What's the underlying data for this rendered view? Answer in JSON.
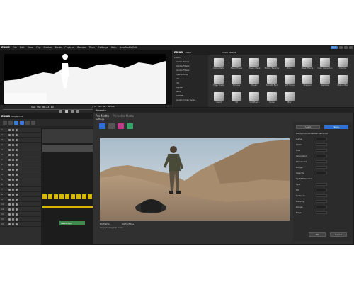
{
  "menubar": {
    "brand": "EDIUS",
    "items": [
      "File",
      "Edit",
      "View",
      "Clip",
      "Marker",
      "Mode",
      "Capture",
      "Render",
      "Tools",
      "Settings",
      "Help",
      "NewProfileEdit"
    ],
    "project_badge": "PLR"
  },
  "player": {
    "timecode": "Sup 00:00:23;10",
    "out_timecode": "TTL 00:00:10;08"
  },
  "bin": {
    "brand": "EDIUS",
    "header": "Folder",
    "tab_label": "Effect Palette",
    "tree": [
      "Effect",
      "Video Filters",
      "Alpha Filters",
      "Audio Filters",
      "Transitions",
      "2D",
      "3D",
      "Alpha",
      "GPU",
      "SMPTE",
      "Audio Cross Fades"
    ],
    "tiles": [
      {
        "label": "Alpha Matte"
      },
      {
        "label": "Blend Filters"
      },
      {
        "label": "Mosaic Mask"
      },
      {
        "label": "Motion Tracking"
      },
      {
        "label": "Proc..."
      },
      {
        "label": "Mask Effects"
      },
      {
        "label": "Color Correction"
      },
      {
        "label": "Chroma"
      },
      {
        "label": "Edge Shade"
      },
      {
        "label": "Emboss"
      },
      {
        "label": "Mosaic"
      },
      {
        "label": "Smooth Blur"
      },
      {
        "label": "Soft Focus"
      },
      {
        "label": "Sharpen"
      },
      {
        "label": "Stabilizer"
      },
      {
        "label": "Motion Blur"
      },
      {
        "label": "Invert"
      },
      {
        "label": "3D"
      },
      {
        "label": "Old Movie"
      },
      {
        "label": "Noise"
      },
      {
        "label": "Blur"
      }
    ]
  },
  "timeline": {
    "brand": "EDIUS",
    "sequence": "Sequence1",
    "tracks": [
      "1",
      "2",
      "3",
      "1",
      "2",
      "3",
      "1",
      "2",
      "3",
      "4",
      "5",
      "6",
      "7",
      "8",
      "9",
      "10",
      "11",
      "12",
      "13",
      "14"
    ],
    "clip_label": "Select Item"
  },
  "dialog": {
    "title": "Primatte",
    "tabs": [
      "Pre-Matte",
      "Primatte Matte"
    ],
    "view_label": "Pre-Matte",
    "settings_label": "Settings",
    "footer_left": "Fill Matte",
    "footer_right": "Alpha Edge",
    "footer_hint": "Output: Original Color",
    "panel": {
      "buttons": [
        "Load",
        "Save"
      ],
      "section1": "Background Shadow Removal",
      "labels": [
        "Luma",
        "Cb/Cr",
        "Hue",
        "Saturation",
        "Threshold",
        "Range",
        "Opacity"
      ],
      "section2": "Spill/Fill Control",
      "labels2": [
        "Spill",
        "Fill",
        "Softness",
        "Density",
        "Range",
        "Edge"
      ],
      "ok": "OK",
      "cancel": "Cancel"
    }
  }
}
